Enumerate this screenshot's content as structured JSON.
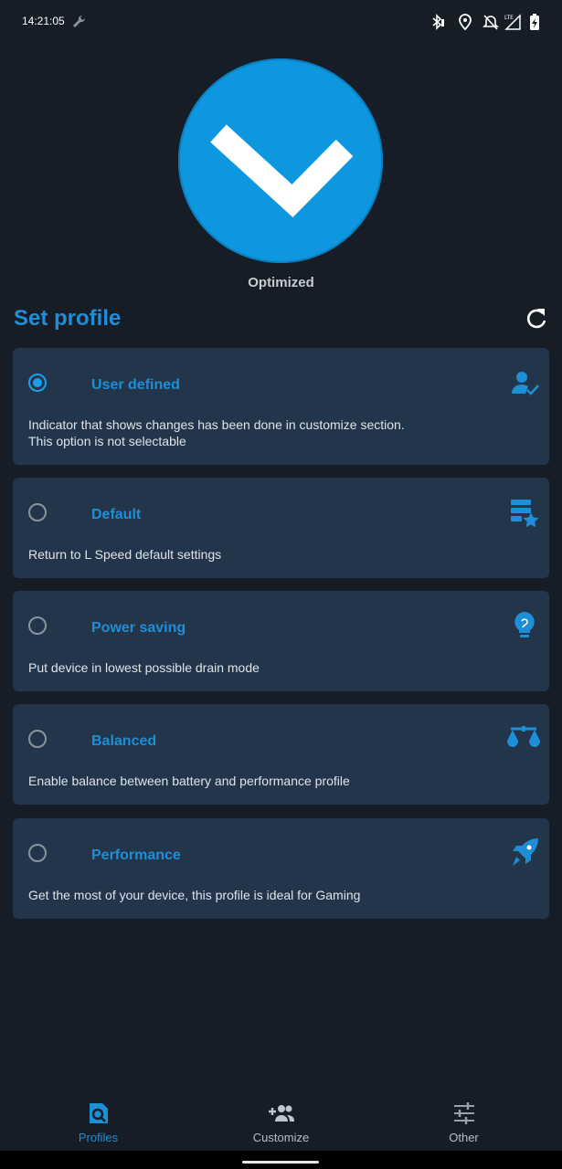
{
  "status_bar": {
    "time": "14:21:05",
    "icons": [
      "wrench-icon",
      "bluetooth-icon",
      "location-icon",
      "alarm-off-icon",
      "lte-signal-icon",
      "battery-charging-icon"
    ]
  },
  "hero": {
    "status_label": "Optimized",
    "icon": "check-icon",
    "accent_color": "#0d97de"
  },
  "section": {
    "title": "Set profile",
    "refresh_icon": "refresh-icon"
  },
  "profiles": [
    {
      "title": "User defined",
      "description_line1": "Indicator that shows changes has been done in customize section.",
      "description_line2": "This option is not selectable",
      "selected": true,
      "icon": "user-check-icon"
    },
    {
      "title": "Default",
      "description_line1": "Return to L Speed default settings",
      "selected": false,
      "icon": "list-star-icon"
    },
    {
      "title": "Power saving",
      "description_line1": "Put device in lowest possible drain mode",
      "selected": false,
      "icon": "lightbulb-icon"
    },
    {
      "title": "Balanced",
      "description_line1": "Enable balance between battery and performance profile",
      "selected": false,
      "icon": "scale-icon"
    },
    {
      "title": "Performance",
      "description_line1": "Get the most of your device, this profile is ideal for Gaming",
      "selected": false,
      "icon": "rocket-icon"
    }
  ],
  "bottom_nav": {
    "items": [
      {
        "label": "Profiles",
        "icon": "profile-search-icon",
        "active": true
      },
      {
        "label": "Customize",
        "icon": "add-people-icon",
        "active": false
      },
      {
        "label": "Other",
        "icon": "sliders-icon",
        "active": false
      }
    ]
  },
  "colors": {
    "background": "#161d27",
    "card": "#23354a",
    "accent": "#1e8ed6"
  }
}
